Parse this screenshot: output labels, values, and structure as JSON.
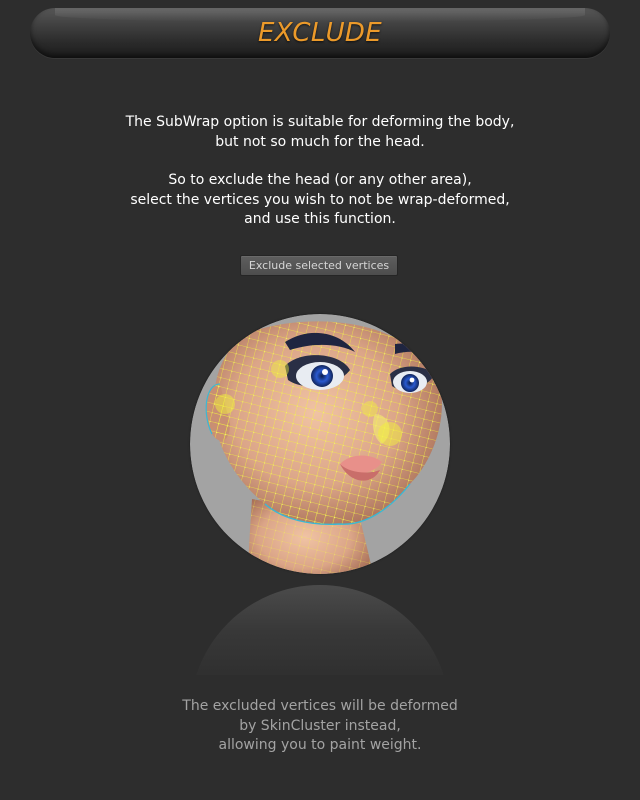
{
  "header": {
    "title": "EXCLUDE"
  },
  "description": {
    "paragraph1": [
      "The SubWrap option is suitable for deforming the body,",
      "but not so much for the head."
    ],
    "paragraph2": [
      "So to exclude the head (or any other area),",
      "select the vertices you wish to not be wrap-deformed,",
      "and use this function."
    ]
  },
  "action": {
    "button_label": "Exclude selected vertices"
  },
  "illustration": {
    "icon": "wireframe-head-illustration",
    "background_color": "#a3a3a3",
    "skin_color": "#dba588",
    "vertex_color": "#f2f03c",
    "wire_color": "#3ab8d4"
  },
  "footer": {
    "lines": [
      "The excluded vertices will be deformed",
      "by SkinCluster instead,",
      "allowing you to paint weight."
    ]
  },
  "colors": {
    "background": "#2d2d2d",
    "title": "#ec9a2a",
    "text": "#ffffff",
    "footer_text": "#a3a3a3"
  }
}
